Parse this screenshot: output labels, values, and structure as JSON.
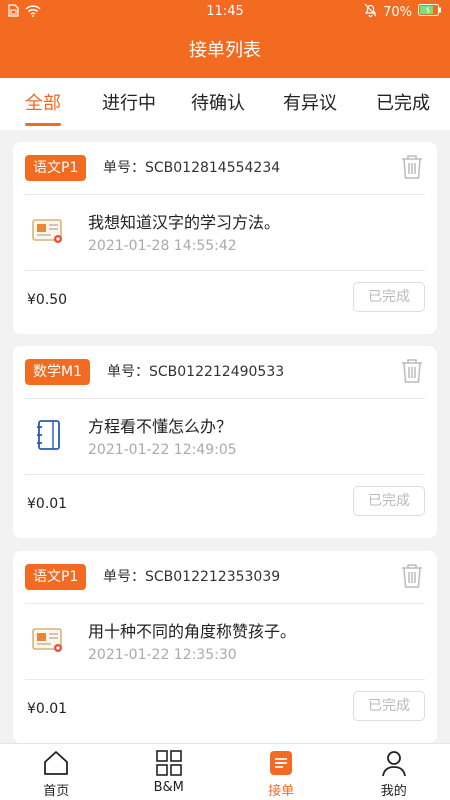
{
  "status_bar": {
    "time": "11:45",
    "battery": "70%",
    "icons": [
      "sim-icon",
      "wifi-icon",
      "bell-off-icon",
      "battery-icon"
    ]
  },
  "header": {
    "title": "接单列表"
  },
  "tabs": [
    {
      "label": "全部",
      "active": true
    },
    {
      "label": "进行中",
      "active": false
    },
    {
      "label": "待确认",
      "active": false
    },
    {
      "label": "有异议",
      "active": false
    },
    {
      "label": "已完成",
      "active": false
    }
  ],
  "orders": [
    {
      "badge": "语文P1",
      "order_no": "单号：SCB012814554234",
      "icon": "certificate-icon",
      "title": "我想知道汉字的学习方法。",
      "time": "2021-01-28 14:55:42",
      "price": "¥0.50",
      "status": "已完成"
    },
    {
      "badge": "数学M1",
      "order_no": "单号：SCB012212490533",
      "icon": "notebook-icon",
      "title": "方程看不懂怎么办？",
      "time": "2021-01-22 12:49:05",
      "price": "¥0.01",
      "status": "已完成"
    },
    {
      "badge": "语文P1",
      "order_no": "单号：SCB012212353039",
      "icon": "certificate-icon",
      "title": "用十种不同的角度称赞孩子。",
      "time": "2021-01-22 12:35:30",
      "price": "¥0.01",
      "status": "已完成"
    }
  ],
  "bottom_nav": [
    {
      "label": "首页",
      "icon": "home-icon",
      "active": false
    },
    {
      "label": "B&M",
      "icon": "grid-icon",
      "active": false
    },
    {
      "label": "接单",
      "icon": "order-list-icon",
      "active": true
    },
    {
      "label": "我的",
      "icon": "person-icon",
      "active": false
    }
  ],
  "colors": {
    "accent": "#f26b21",
    "background": "#f2f2f2",
    "muted_text": "#aaaaaa"
  }
}
